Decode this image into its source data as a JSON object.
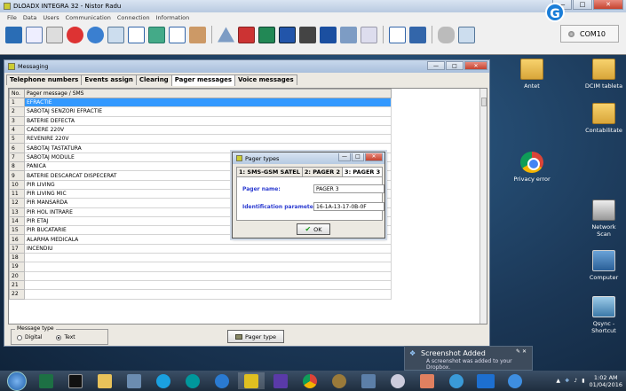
{
  "app": {
    "title": "DLOADX INTEGRA 32 - Nistor Radu",
    "menu": [
      "File",
      "Data",
      "Users",
      "Communication",
      "Connection",
      "Information"
    ],
    "com_port": "COM10",
    "window_buttons": {
      "minimize": "—",
      "maximize": "□",
      "close": "✕"
    }
  },
  "desktop_icons": [
    {
      "label": "Antet",
      "icon": "folder-icon"
    },
    {
      "label": "DCIM tableta",
      "icon": "folder-icon"
    },
    {
      "label": "Contabilitate",
      "icon": "folder-icon"
    },
    {
      "label": "Privacy error",
      "icon": "chrome-icon"
    },
    {
      "label": "Network Scan",
      "icon": "printer-icon"
    },
    {
      "label": "Computer",
      "icon": "computer-icon"
    },
    {
      "label": "Qsync - Shortcut",
      "icon": "qsync-icon"
    }
  ],
  "messaging": {
    "title": "Messaging",
    "tabs": [
      "Telephone numbers",
      "Events assign",
      "Clearing",
      "Pager messages",
      "Voice messages"
    ],
    "active_tab": 3,
    "columns": [
      "No.",
      "Pager message / SMS"
    ],
    "rows": [
      {
        "no": "1",
        "msg": "EFRACTIE"
      },
      {
        "no": "2",
        "msg": "SABOTAJ SENZORI EFRACTIE"
      },
      {
        "no": "3",
        "msg": "BATERIE DEFECTA"
      },
      {
        "no": "4",
        "msg": "CADERE 220V"
      },
      {
        "no": "5",
        "msg": "REVENIRE 220V"
      },
      {
        "no": "6",
        "msg": "SABOTAJ TASTATURA"
      },
      {
        "no": "7",
        "msg": "SABOTAJ MODULE"
      },
      {
        "no": "8",
        "msg": "PANICA"
      },
      {
        "no": "9",
        "msg": "BATERIE DESCARCAT DISPECERAT"
      },
      {
        "no": "10",
        "msg": "PIR LIVING"
      },
      {
        "no": "11",
        "msg": "PIR LIVING MIC"
      },
      {
        "no": "12",
        "msg": "PIR MANSARDA"
      },
      {
        "no": "13",
        "msg": "PIR HOL INTRARE"
      },
      {
        "no": "14",
        "msg": "PIR ETAJ"
      },
      {
        "no": "15",
        "msg": "PIR BUCATARIE"
      },
      {
        "no": "16",
        "msg": "ALARMA MEDICALA"
      },
      {
        "no": "17",
        "msg": "INCENDIU"
      },
      {
        "no": "18",
        "msg": ""
      },
      {
        "no": "19",
        "msg": ""
      },
      {
        "no": "20",
        "msg": ""
      },
      {
        "no": "21",
        "msg": ""
      },
      {
        "no": "22",
        "msg": ""
      }
    ],
    "selected_row": 0,
    "message_type": {
      "legend": "Message type",
      "options": [
        "Digital",
        "Text"
      ],
      "selected": "Text"
    },
    "pager_type_button": "Pager type"
  },
  "pager_dialog": {
    "title": "Pager types",
    "tabs": [
      "1: SMS-GSM SATEL",
      "2: PAGER 2",
      "3: PAGER 3"
    ],
    "active_tab": 2,
    "pager_name_label": "Pager name:",
    "pager_name_value": "PAGER 3",
    "id_params_label": "Identification parameters:",
    "id_params_value": "16-1A-13-17-0B-0F",
    "ok_label": "OK"
  },
  "toast": {
    "title": "Screenshot Added",
    "text": "A screenshot was added to your Dropbox."
  },
  "taskbar": {
    "time": "1:02 AM",
    "date": "01/04/2016"
  }
}
